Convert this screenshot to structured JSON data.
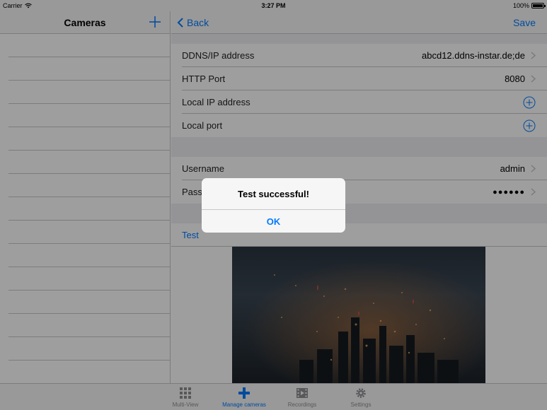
{
  "status_bar": {
    "carrier": "Carrier",
    "time": "3:27 PM",
    "battery": "100%"
  },
  "left_panel": {
    "title": "Cameras",
    "add_icon": "plus-icon"
  },
  "nav": {
    "back_label": "Back",
    "save_label": "Save"
  },
  "settings": {
    "ddns_label": "DDNS/IP address",
    "ddns_value": "abcd12.ddns-instar.de;de",
    "http_port_label": "HTTP Port",
    "http_port_value": "8080",
    "local_ip_label": "Local IP address",
    "local_port_label": "Local port",
    "username_label": "Username",
    "username_value": "admin",
    "password_label": "Pass",
    "password_value": "●●●●●●",
    "test_label": "Test"
  },
  "alert": {
    "title": "Test successful!",
    "ok_label": "OK"
  },
  "tab_bar": {
    "tabs": [
      {
        "label": "Multi-View",
        "icon": "grid-icon"
      },
      {
        "label": "Manage cameras",
        "icon": "plus-icon"
      },
      {
        "label": "Recordings",
        "icon": "film-icon"
      },
      {
        "label": "Settings",
        "icon": "gear-icon"
      }
    ],
    "active_index": 1
  },
  "colors": {
    "accent": "#007aff",
    "separator": "#c8c7cc",
    "group_bg": "#efeff4"
  }
}
